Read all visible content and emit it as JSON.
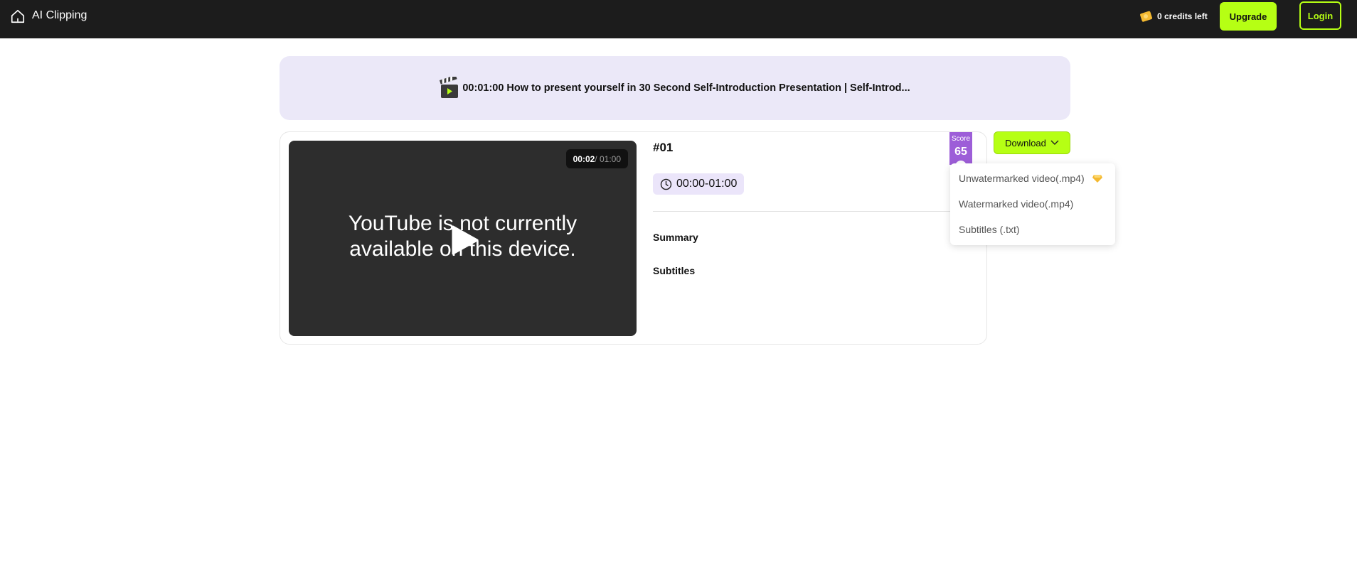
{
  "header": {
    "app_title": "AI Clipping",
    "credits_text": "0 credits left",
    "upgrade_label": "Upgrade",
    "login_label": "Login",
    "accent_color": "#b6ff14"
  },
  "banner": {
    "title": "00:01:00 How to present yourself in 30 Second Self-Introduction Presentation | Self-Introd...",
    "icon": "clapperboard-icon"
  },
  "clip": {
    "number": "#01",
    "time_range": "00:00-01:00",
    "summary_label": "Summary",
    "subtitles_label": "Subtitles",
    "score_label": "Score",
    "score_value": "65",
    "video": {
      "current_time": "00:02",
      "total_time": "/ 01:00",
      "message_line1": "YouTube is not currently",
      "message_line2": "available on this device."
    }
  },
  "download": {
    "label": "Download",
    "options": [
      {
        "label": "Unwatermarked video(.mp4)",
        "premium_icon": "diamond-icon"
      },
      {
        "label": "Watermarked video(.mp4)"
      },
      {
        "label": "Subtitles (.txt)"
      }
    ]
  }
}
